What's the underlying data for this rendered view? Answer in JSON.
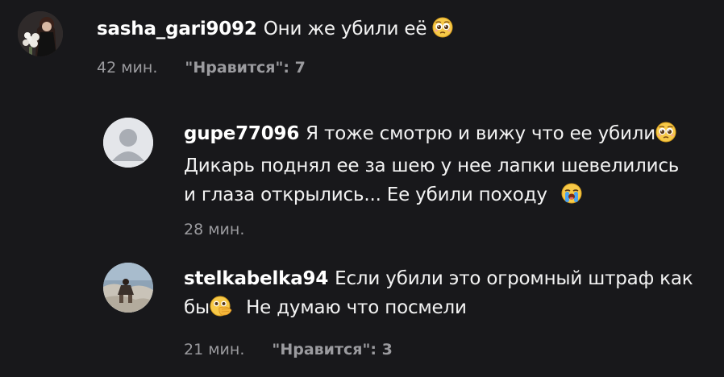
{
  "comments": [
    {
      "username": "sasha_gari9092",
      "text": "Они же убили её",
      "emoji": "pleading-face",
      "time": "42 мин.",
      "likes_label": "\"Нравится\": 7"
    },
    {
      "username": "gupe77096",
      "line1": "Я тоже смотрю и вижу что ее убили",
      "line2": "Дикарь поднял ее за шею у нее лапки шевелились",
      "line3": "и глаза открылись... Ее убили походу",
      "emoji1": "pleading-face",
      "emoji2": "loudly-crying-face",
      "time": "28 мин."
    },
    {
      "username": "stelkabelka94",
      "line1": "Если убили это огромный штраф как",
      "line2_prefix": "бы",
      "line2_suffix": "Не думаю что посмели",
      "emoji": "face-with-hand-over-mouth",
      "time": "21 мин.",
      "likes_label": "\"Нравится\": 3"
    }
  ]
}
